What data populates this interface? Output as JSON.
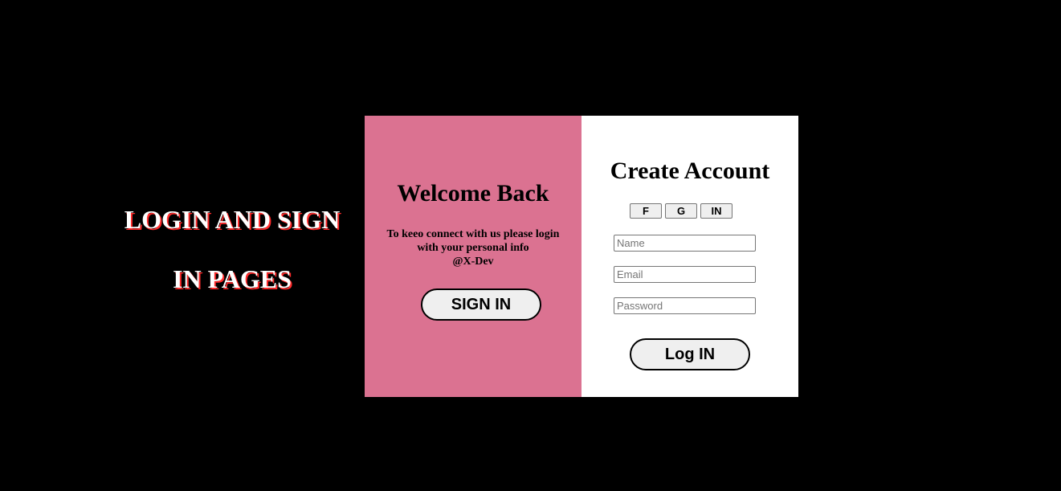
{
  "side": {
    "title_line1": "LOGIN AND SIGN",
    "title_line2": "IN PAGES"
  },
  "welcome": {
    "title": "Welcome Back",
    "text_line1": "To keeo connect with us please login",
    "text_line2": "with your personal info",
    "text_line3": "@X-Dev",
    "signin_label": "SIGN IN"
  },
  "create": {
    "title": "Create Account",
    "social": [
      "F",
      "G",
      "IN"
    ],
    "fields": {
      "name_placeholder": "Name",
      "email_placeholder": "Email",
      "password_placeholder": "Password"
    },
    "login_label": "Log IN"
  },
  "colors": {
    "background": "#000000",
    "panel_pink": "#db7291",
    "panel_white": "#ffffff"
  }
}
